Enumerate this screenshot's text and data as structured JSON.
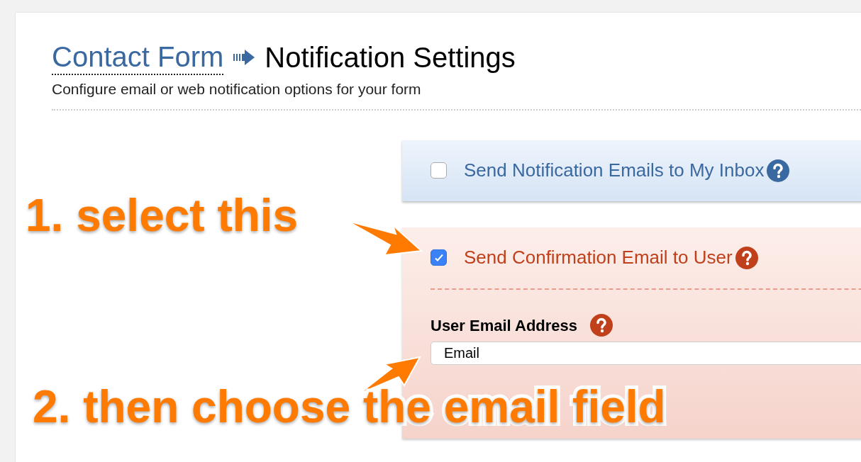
{
  "breadcrumb": {
    "parent": "Contact Form",
    "current": "Notification Settings"
  },
  "subtitle": "Configure email or web notification options for your form",
  "sections": [
    {
      "kind": "info",
      "label": "Send Notification Emails to My Inbox",
      "checked": false
    },
    {
      "kind": "alert",
      "label": "Send Confirmation Email to User",
      "checked": true,
      "field": {
        "label": "User Email Address",
        "value": "Email"
      }
    }
  ],
  "annotations": [
    {
      "text": "1. select this"
    },
    {
      "text": "2. then choose the email field"
    }
  ]
}
